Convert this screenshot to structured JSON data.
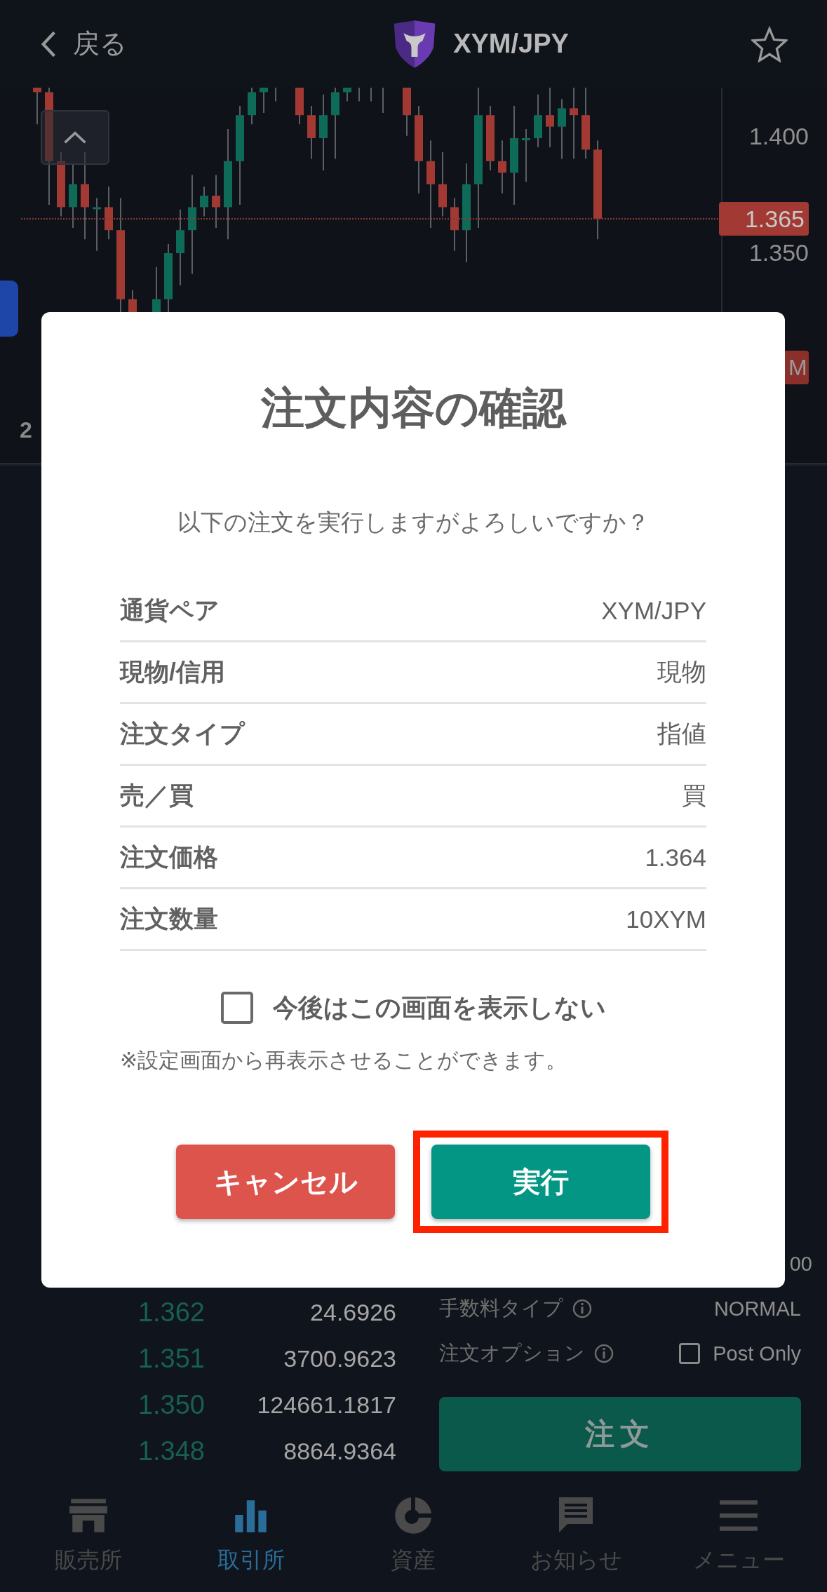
{
  "header": {
    "back_label": "戻る",
    "pair": "XYM/JPY",
    "favorite": false
  },
  "chart": {
    "price_ticks": [
      "1.400",
      "1.350"
    ],
    "current_price": "1.365",
    "side_tag": "M",
    "date_label": "2"
  },
  "order_book": [
    {
      "price": "1.362",
      "amount": "24.6926"
    },
    {
      "price": "1.351",
      "amount": "3700.9623"
    },
    {
      "price": "1.350",
      "amount": "124661.1817"
    },
    {
      "price": "1.348",
      "amount": "8864.9364"
    }
  ],
  "order_form": {
    "cut_value": "00",
    "fee_label": "手数料タイプ",
    "fee_value": "NORMAL",
    "option_label": "注文オプション",
    "post_only": {
      "label": "Post Only",
      "checked": false
    },
    "submit": "注文"
  },
  "nav": [
    {
      "label": "販売所",
      "kind": "store",
      "selected": false
    },
    {
      "label": "取引所",
      "kind": "bars",
      "selected": true
    },
    {
      "label": "資産",
      "kind": "pie",
      "selected": false
    },
    {
      "label": "お知らせ",
      "kind": "chat",
      "selected": false
    },
    {
      "label": "メニュー",
      "kind": "menu",
      "selected": false
    }
  ],
  "dialog": {
    "title": "注文内容の確認",
    "question": "以下の注文を実行しますがよろしいですか？",
    "rows": [
      {
        "label": "通貨ペア",
        "value": "XYM/JPY"
      },
      {
        "label": "現物/信用",
        "value": "現物"
      },
      {
        "label": "注文タイプ",
        "value": "指値"
      },
      {
        "label": "売／買",
        "value": "買"
      },
      {
        "label": "注文価格",
        "value": "1.364"
      },
      {
        "label": "注文数量",
        "value": "10XYM"
      }
    ],
    "dont_show": {
      "label": "今後はこの画面を表示しない",
      "checked": false
    },
    "note": "※設定画面から再表示させることができます。",
    "buttons": [
      {
        "label": "キャンセル",
        "kind": "cancel",
        "highlighted": false
      },
      {
        "label": "実行",
        "kind": "confirm",
        "highlighted": true
      }
    ]
  }
}
